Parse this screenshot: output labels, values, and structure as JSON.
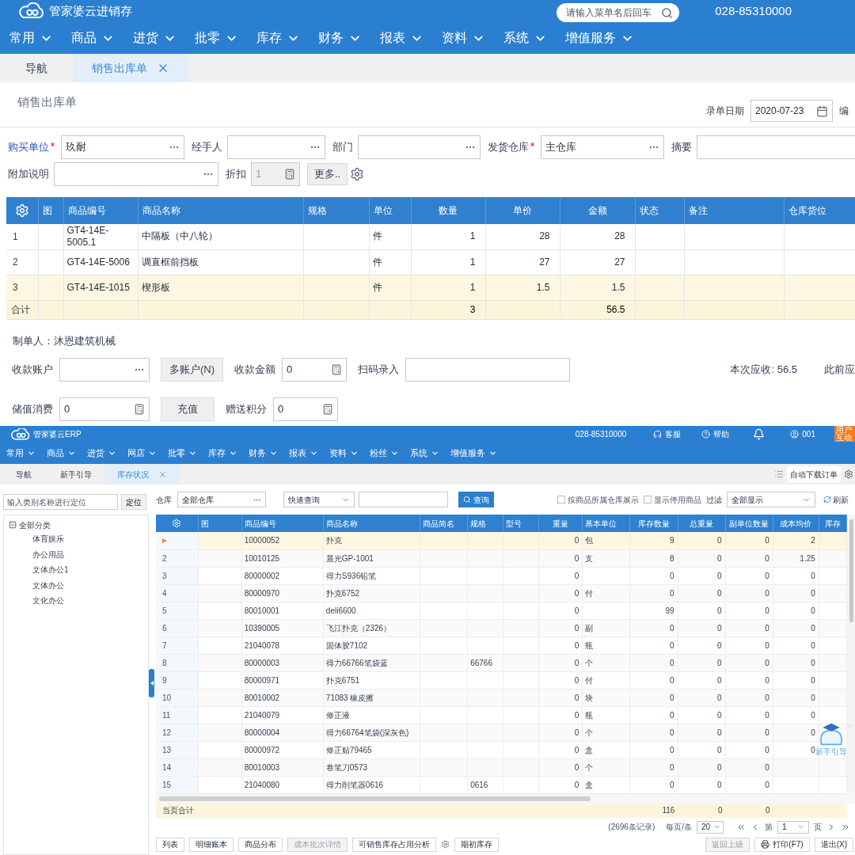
{
  "sales_window": {
    "header": {
      "logo": "管家婆云进销存",
      "search": {
        "placeholder": "请输入菜单名后回车"
      },
      "phone": "028-85310000"
    },
    "menu": [
      "常用",
      "商品",
      "进货",
      "批零",
      "库存",
      "财务",
      "报表",
      "资料",
      "系统",
      "增值服务"
    ],
    "tabs": [
      {
        "label": "导航",
        "selected": false,
        "closable": false
      },
      {
        "label": "销售出库单",
        "selected": true,
        "closable": true
      }
    ],
    "title": "销售出库单",
    "date": {
      "label": "录单日期",
      "value": "2020-07-23",
      "kind": "date",
      "disabled": false
    },
    "cut_label": "编",
    "form_row_1": [
      {
        "label": "购买单位",
        "kind": "lookup",
        "required": true,
        "link": true,
        "disabled": false,
        "value": "玖耐"
      },
      {
        "label": "经手人",
        "kind": "lookup",
        "required": false,
        "link": false,
        "disabled": false
      },
      {
        "label": "部门",
        "kind": "lookup",
        "required": false,
        "link": false,
        "disabled": false
      },
      {
        "label": "发货仓库",
        "kind": "lookup",
        "required": true,
        "link": false,
        "disabled": false,
        "value": "主仓库"
      },
      {
        "label": "摘要",
        "kind": "text",
        "required": false,
        "link": false,
        "disabled": false
      }
    ],
    "form_row_2": [
      {
        "label": "附加说明",
        "kind": "lookup",
        "required": false,
        "link": false,
        "disabled": false
      },
      {
        "label": "折扣",
        "kind": "number",
        "required": false,
        "link": false,
        "disabled": true,
        "value": "1"
      }
    ],
    "more_button": "更多..",
    "table": {
      "columns": [
        {
          "label": "图",
          "numeric": false
        },
        {
          "label": "商品编号",
          "numeric": false
        },
        {
          "label": "商品名称",
          "numeric": false
        },
        {
          "label": "规格",
          "numeric": false
        },
        {
          "label": "单位",
          "numeric": false
        },
        {
          "label": "数量",
          "numeric": true
        },
        {
          "label": "单价",
          "numeric": true
        },
        {
          "label": "金额",
          "numeric": true
        },
        {
          "label": "状态",
          "numeric": false
        },
        {
          "label": "备注",
          "numeric": false
        },
        {
          "label": "仓库货位",
          "numeric": false
        }
      ],
      "rows": [
        {
          "no": "1",
          "selected": false,
          "cells": [
            null,
            "GT4-14E-5005.1",
            "中隔板（中八轮）",
            null,
            "件",
            "1",
            "28",
            "28"
          ]
        },
        {
          "no": "2",
          "selected": false,
          "cells": [
            null,
            "GT4-14E-5006",
            "调直框前挡板",
            null,
            "件",
            "1",
            "27",
            "27"
          ]
        },
        {
          "no": "3",
          "selected": true,
          "cells": [
            null,
            "GT4-14E-1015",
            "楔形板",
            null,
            "件",
            "1",
            "1.5",
            "1.5"
          ]
        }
      ],
      "totals": {
        "label": "合计",
        "cells": [
          null,
          null,
          null,
          null,
          null,
          "3",
          null,
          "56.5"
        ]
      }
    },
    "maker": "制单人：沐恩建筑机械",
    "payment_row_1": [
      {
        "kind": "lookup",
        "label": "收款账户"
      },
      {
        "kind": "button",
        "label": "多账户(N)"
      },
      {
        "kind": "number",
        "label": "收款金额",
        "value": "0"
      },
      {
        "kind": "text",
        "label": "扫码录入"
      }
    ],
    "receivable": {
      "label": "本次应收:",
      "value": "56.5"
    },
    "cut_label_2": "此前应",
    "payment_row_2": [
      {
        "kind": "number",
        "label": "储值消费",
        "value": "0"
      },
      {
        "kind": "button",
        "label": "充值"
      },
      {
        "kind": "number",
        "label": "赠送积分",
        "value": "0"
      }
    ]
  },
  "inventory_window": {
    "header": {
      "logo": "管家婆云ERP",
      "phone": "028-85310000",
      "service": "客服",
      "help": "帮助",
      "user": "001",
      "badge": "用户互动"
    },
    "menu": [
      "常用",
      "商品",
      "进货",
      "网店",
      "批零",
      "库存",
      "财务",
      "报表",
      "资料",
      "粉丝",
      "系统",
      "增值服务"
    ],
    "tabs": [
      {
        "label": "导航",
        "selected": false,
        "closable": false
      },
      {
        "label": "新手引导",
        "selected": false,
        "closable": false
      },
      {
        "label": "库存状况",
        "selected": true,
        "closable": true
      }
    ],
    "toolbar_button": "自动下载订单",
    "sidebar": {
      "search": {
        "placeholder": "输入类别名称进行定位"
      },
      "locate_button": "定位",
      "tree": [
        {
          "label": "全部分类",
          "expanded": true,
          "children": [
            {
              "label": "体育娱乐"
            },
            {
              "label": "办公用品"
            },
            {
              "label": "文体办公1"
            },
            {
              "label": "文体办公"
            },
            {
              "label": "文化办公"
            }
          ]
        }
      ]
    },
    "filters": {
      "warehouse_label": "仓库",
      "warehouse": "全部仓库",
      "query_mode": "快速查询",
      "query_button": "查询",
      "checkboxes": [
        {
          "label": "按商品所属仓库展示",
          "checked": false
        },
        {
          "label": "显示停用商品",
          "checked": false
        }
      ],
      "filter_label": "过滤",
      "filter_value": "全部显示",
      "refresh": "刷新"
    },
    "table": {
      "columns": [
        {
          "label": "图",
          "numeric": false
        },
        {
          "label": "商品编号",
          "numeric": false
        },
        {
          "label": "商品名称",
          "numeric": false
        },
        {
          "label": "商品简名",
          "numeric": false
        },
        {
          "label": "规格",
          "numeric": false
        },
        {
          "label": "型号",
          "numeric": false
        },
        {
          "label": "重量",
          "numeric": true
        },
        {
          "label": "基本单位",
          "numeric": false
        },
        {
          "label": "库存数量",
          "numeric": true
        },
        {
          "label": "总重量",
          "numeric": true
        },
        {
          "label": "副单位数量",
          "numeric": true
        },
        {
          "label": "成本均价",
          "numeric": true
        },
        {
          "label": "库存",
          "numeric": true
        }
      ],
      "rows": [
        {
          "current": true,
          "cells": [
            null,
            "10000052",
            "扑克",
            null,
            null,
            null,
            "0",
            "包",
            "9",
            "0",
            "0",
            "2"
          ]
        },
        {
          "no": "2",
          "current": false,
          "cells": [
            null,
            "10010125",
            "晨光GP-1001",
            null,
            null,
            null,
            "0",
            "支",
            "8",
            "0",
            "0",
            "1.25"
          ]
        },
        {
          "no": "3",
          "current": false,
          "cells": [
            null,
            "80000002",
            "得力S936铅笔",
            null,
            null,
            null,
            "0",
            null,
            "0",
            "0",
            "0",
            "0"
          ]
        },
        {
          "no": "4",
          "current": false,
          "cells": [
            null,
            "80000970",
            "扑克6752",
            null,
            null,
            null,
            "0",
            "付",
            "0",
            "0",
            "0",
            "0"
          ]
        },
        {
          "no": "5",
          "current": false,
          "cells": [
            null,
            "80010001",
            "deli6600",
            null,
            null,
            null,
            "0",
            null,
            "99",
            "0",
            "0",
            "0"
          ]
        },
        {
          "no": "6",
          "current": false,
          "cells": [
            null,
            "10390005",
            "飞江扑克（2326）",
            null,
            null,
            null,
            "0",
            "副",
            "0",
            "0",
            "0",
            "0"
          ]
        },
        {
          "no": "7",
          "current": false,
          "cells": [
            null,
            "21040078",
            "固体胶7102",
            null,
            null,
            null,
            "0",
            "瓶",
            "0",
            "0",
            "0",
            "0"
          ]
        },
        {
          "no": "8",
          "current": false,
          "cells": [
            null,
            "80000003",
            "得力66766笔袋蓝",
            null,
            "66766",
            null,
            "0",
            "个",
            "0",
            "0",
            "0",
            "0"
          ]
        },
        {
          "no": "9",
          "current": false,
          "cells": [
            null,
            "80000971",
            "扑克6751",
            null,
            null,
            null,
            "0",
            "付",
            "0",
            "0",
            "0",
            "0"
          ]
        },
        {
          "no": "10",
          "current": false,
          "cells": [
            null,
            "80010002",
            "71083 橡皮擦",
            null,
            null,
            null,
            "0",
            "块",
            "0",
            "0",
            "0",
            "0"
          ]
        },
        {
          "no": "11",
          "current": false,
          "cells": [
            null,
            "21040079",
            "修正液",
            null,
            null,
            null,
            "0",
            "瓶",
            "0",
            "0",
            "0",
            "0"
          ]
        },
        {
          "no": "12",
          "current": false,
          "cells": [
            null,
            "80000004",
            "得力66764笔袋(深灰色)",
            null,
            null,
            null,
            "0",
            "个",
            "0",
            "0",
            "0",
            "0"
          ]
        },
        {
          "no": "13",
          "current": false,
          "cells": [
            null,
            "80000972",
            "修正贴79465",
            null,
            null,
            null,
            "0",
            "盒",
            "0",
            "0",
            "0",
            "0"
          ]
        },
        {
          "no": "14",
          "current": false,
          "cells": [
            null,
            "80010003",
            "卷笔刀0573",
            null,
            null,
            null,
            "0",
            "个",
            "0",
            "0",
            "0"
          ]
        },
        {
          "no": "15",
          "current": false,
          "cells": [
            null,
            "21040080",
            "得力削笔器0616",
            null,
            "0616",
            null,
            "0",
            "盒",
            "0",
            "0",
            "0"
          ]
        }
      ],
      "totals": {
        "label": "当页合计",
        "cells": [
          null,
          null,
          null,
          null,
          null,
          null,
          null,
          null,
          "116",
          "0",
          "0"
        ]
      }
    },
    "pagination": {
      "records": "(2696条记录)",
      "per_page_label": "每页/条",
      "per_page": "20",
      "page_prefix": "第",
      "page": "1",
      "page_suffix": "页"
    },
    "buttons": [
      {
        "label": "列表",
        "disabled": false
      },
      {
        "label": "明细账本",
        "disabled": false
      },
      {
        "label": "商品分布",
        "disabled": false
      },
      {
        "label": "成本批次详情",
        "disabled": true
      },
      {
        "label": "可销售库存占用分析",
        "disabled": false
      }
    ],
    "buttons_after_gear": [
      {
        "label": "期初库存",
        "disabled": false
      }
    ],
    "right_buttons": [
      {
        "label": "返回上级",
        "disabled": true,
        "kind": "plain"
      },
      {
        "label": "打印(F7)",
        "disabled": false,
        "kind": "print"
      },
      {
        "label": "退出(X)",
        "disabled": false,
        "kind": "plain"
      }
    ],
    "guide": {
      "label": "新手引导"
    }
  }
}
